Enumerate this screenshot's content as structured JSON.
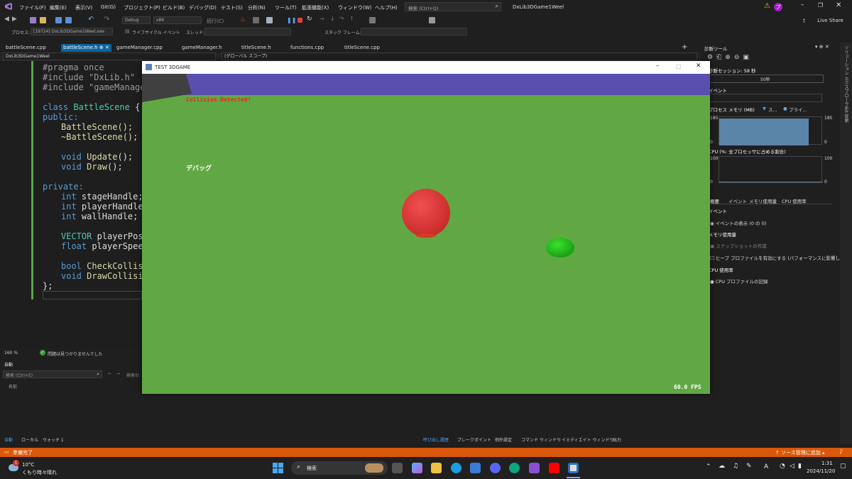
{
  "menubar": {
    "items": [
      "ファイル(F)",
      "編集(E)",
      "表示(V)",
      "Git(G)",
      "プロジェクト(P)",
      "ビルド(B)",
      "デバッグ(D)",
      "テスト(S)",
      "分析(N)",
      "ツール(T)",
      "拡張機能(X)",
      "ウィンドウ(W)",
      "ヘルプ(H)"
    ],
    "search_placeholder": "検索 (Ctrl+Q)",
    "solution_title": "DxLib3DGame1Weel",
    "user_badge": "プ",
    "live_share": "Live Share"
  },
  "toolbar": {
    "config": "Debug",
    "platform": "x86",
    "continue": "続行(C)",
    "process_label": "プロセス:",
    "process_value": "[19724] DxLib3DGame1Weel.exe",
    "lifecycle": "ライフサイクル イベント",
    "thread": "スレッド:",
    "stackframe": "スタック フレーム:"
  },
  "tabs": [
    "battleScene.cpp",
    "battleScene.h",
    "gameManager.cpp",
    "gameManager.h",
    "titleScene.h",
    "functions.cpp",
    "titleScene.cpp"
  ],
  "active_tab_index": 1,
  "navbar": {
    "project": "DxLib3DGame1Weel",
    "scope": "(グローバル スコープ)"
  },
  "code": {
    "l1": "#pragma once",
    "l2": "#include \"DxLib.h\"",
    "l3": "#include \"gameManager.",
    "l5a": "class ",
    "l5b": "BattleScene",
    "l5c": " {",
    "l6": "public:",
    "l7": "BattleScene();",
    "l8": "~BattleScene();",
    "l10a": "void ",
    "l10b": "Update",
    "l10c": "();",
    "l11a": "void ",
    "l11b": "Draw",
    "l11c": "();",
    "l13": "private:",
    "l14a": "int ",
    "l14b": "stageHandle;",
    "l15a": "int ",
    "l15b": "playerHandle;",
    "l16a": "int ",
    "l16b": "wallHandle;",
    "l18a": "VECTOR ",
    "l18b": "playerPos;",
    "l19a": "float ",
    "l19b": "playerSpeed;",
    "l21a": "bool ",
    "l21b": "CheckCollisio",
    "l22a": "void ",
    "l22b": "DrawCollision",
    "l23": "};"
  },
  "editor_status": {
    "zoom": "160 %",
    "issues": "問題は見つかりませんでした"
  },
  "auto_panel": {
    "title": "自動",
    "search": "検索 (Ctrl+E)",
    "search_depth": "検索の",
    "col_name": "名前"
  },
  "bottom_tabs_left": [
    "自動",
    "ローカル",
    "ウォッチ 1"
  ],
  "bottom_tabs_right": [
    "呼び出し履歴",
    "ブレークポイント",
    "例外設定",
    "コマンド ウィンドウ",
    "イミディエイト ウィンドウ",
    "出力"
  ],
  "diag": {
    "title": "診断ツール",
    "session": "診断セッション: 58 秒",
    "time_mark": "50秒",
    "events_hd": "イベント",
    "memory_hd": "プロセス メモリ (MB)",
    "legend_snap": "ス...",
    "legend_private": "プライ...",
    "mem_top": "185",
    "mem_top_r": "185",
    "mem_bottom": "0",
    "mem_bottom_r": "0",
    "cpu_hd": "CPU (%: 全プロセッサに占める割合)",
    "cpu_top": "100",
    "cpu_top_r": "100",
    "cpu_bottom": "0",
    "cpu_bottom_r": "0",
    "tabs": [
      "概要",
      "イベント",
      "メモリ使用量",
      "CPU 使用率"
    ],
    "sec_events": "イベント",
    "show_events": "イベントの表示 (0 の 0)",
    "sec_memory": "メモリ使用量",
    "snapshot": "スナップショットの作成",
    "heap": "ヒープ プロファイルを有効にする (パフォーマンスに影響しま",
    "sec_cpu": "CPU 使用率",
    "cpu_record": "CPU プロファイルの記録"
  },
  "side_tabs": [
    "ソリューション エクスプローラー",
    "Git 変更"
  ],
  "game": {
    "window_title": "TEST 3DGAME",
    "collision_text": "Collision Detected!",
    "debug_text": "デバッグ",
    "fps_text": "60.0 FPS",
    "colors": {
      "ground": "#61a845",
      "wall": "#5a4fae",
      "red_ball": "#e23a3a",
      "green_ball": "#22c41a"
    }
  },
  "vs_status": {
    "ready": "準備完了",
    "source_control": "ソース管理に追加"
  },
  "taskbar": {
    "weather_temp": "10°C",
    "weather_desc": "くもり時々晴れ",
    "weather_badge": "1",
    "search": "検索",
    "time": "1:31",
    "date": "2024/11/20",
    "ime": "A"
  }
}
